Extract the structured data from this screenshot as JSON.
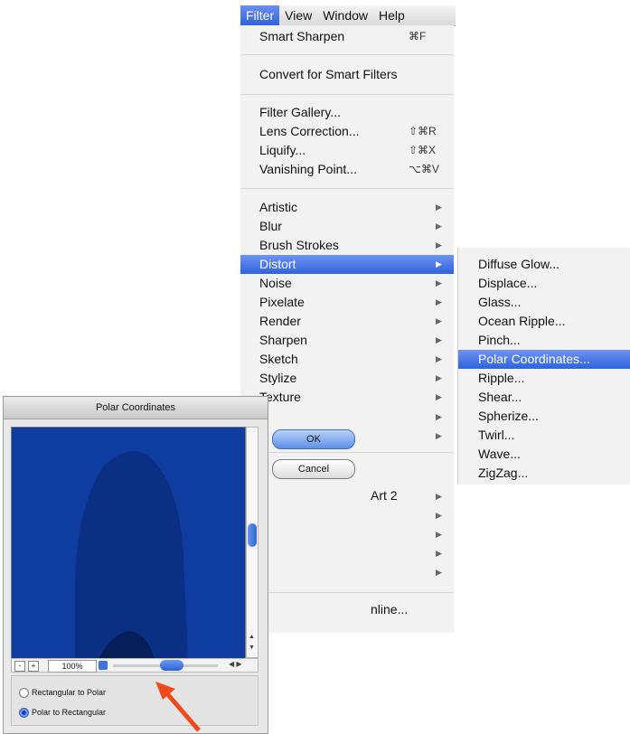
{
  "menubar": {
    "items": [
      "Filter",
      "View",
      "Window",
      "Help"
    ]
  },
  "filter_menu": {
    "smart_sharpen": {
      "label": "Smart Sharpen",
      "shortcut": "⌘F"
    },
    "convert": "Convert for Smart Filters",
    "filter_gallery": "Filter Gallery...",
    "lens_correction": {
      "label": "Lens Correction...",
      "shortcut": "⇧⌘R"
    },
    "liquify": {
      "label": "Liquify...",
      "shortcut": "⇧⌘X"
    },
    "vanishing_point": {
      "label": "Vanishing Point...",
      "shortcut": "⌥⌘V"
    },
    "submenus": [
      "Artistic",
      "Blur",
      "Brush Strokes",
      "Distort",
      "Noise",
      "Pixelate",
      "Render",
      "Sharpen",
      "Sketch",
      "Stylize",
      "Texture"
    ],
    "highlighted": "Distort",
    "lower_fragments": {
      "art2": "Art 2",
      "online": "nline..."
    }
  },
  "distort_submenu": {
    "items": [
      "Diffuse Glow...",
      "Displace...",
      "Glass...",
      "Ocean Ripple...",
      "Pinch...",
      "Polar Coordinates...",
      "Ripple...",
      "Shear...",
      "Spherize...",
      "Twirl...",
      "Wave...",
      "ZigZag..."
    ],
    "highlighted": "Polar Coordinates..."
  },
  "dialog": {
    "title": "Polar Coordinates",
    "ok_label": "OK",
    "cancel_label": "Cancel",
    "zoom": "100%",
    "zoom_out": "-",
    "zoom_in": "+",
    "options": [
      {
        "label": "Rectangular to Polar",
        "selected": false
      },
      {
        "label": "Polar to Rectangular",
        "selected": true
      }
    ]
  },
  "colors": {
    "highlight": "#2f62dd",
    "preview_bg": "#0d3a9c",
    "annotation_arrow": "#f04a1c"
  }
}
